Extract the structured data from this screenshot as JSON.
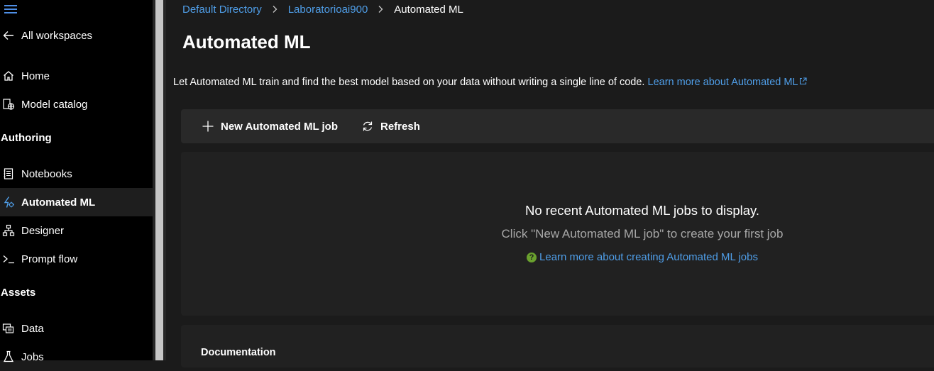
{
  "sidebar": {
    "back_label": "All workspaces",
    "items_top": [
      {
        "label": "Home",
        "icon": "home-icon"
      },
      {
        "label": "Model catalog",
        "icon": "model-catalog-icon"
      }
    ],
    "authoring_heading": "Authoring",
    "authoring_items": [
      {
        "label": "Notebooks",
        "icon": "notebook-icon"
      },
      {
        "label": "Automated ML",
        "icon": "automated-ml-icon",
        "active": true
      },
      {
        "label": "Designer",
        "icon": "designer-icon"
      },
      {
        "label": "Prompt flow",
        "icon": "prompt-flow-icon"
      }
    ],
    "assets_heading": "Assets",
    "assets_items": [
      {
        "label": "Data",
        "icon": "data-icon"
      },
      {
        "label": "Jobs",
        "icon": "jobs-icon"
      }
    ]
  },
  "breadcrumb": {
    "items": [
      "Default Directory",
      "Laboratorioai900"
    ],
    "current": "Automated ML",
    "separator": ">"
  },
  "page": {
    "title": "Automated ML",
    "intro_text": "Let Automated ML train and find the best model based on your data without writing a single line of code.",
    "intro_link": "Learn more about Automated ML"
  },
  "toolbar": {
    "new_job_label": "New Automated ML job",
    "refresh_label": "Refresh"
  },
  "empty_state": {
    "title": "No recent Automated ML jobs to display.",
    "subtitle": "Click \"New Automated ML job\" to create your first job",
    "link": "Learn more about creating Automated ML jobs",
    "help_glyph": "?"
  },
  "documentation": {
    "title": "Documentation"
  },
  "colors": {
    "link": "#4f9ee8",
    "sidebar_bg": "#000000",
    "main_bg": "#1b1b1b",
    "help_icon": "#6aa12e"
  }
}
